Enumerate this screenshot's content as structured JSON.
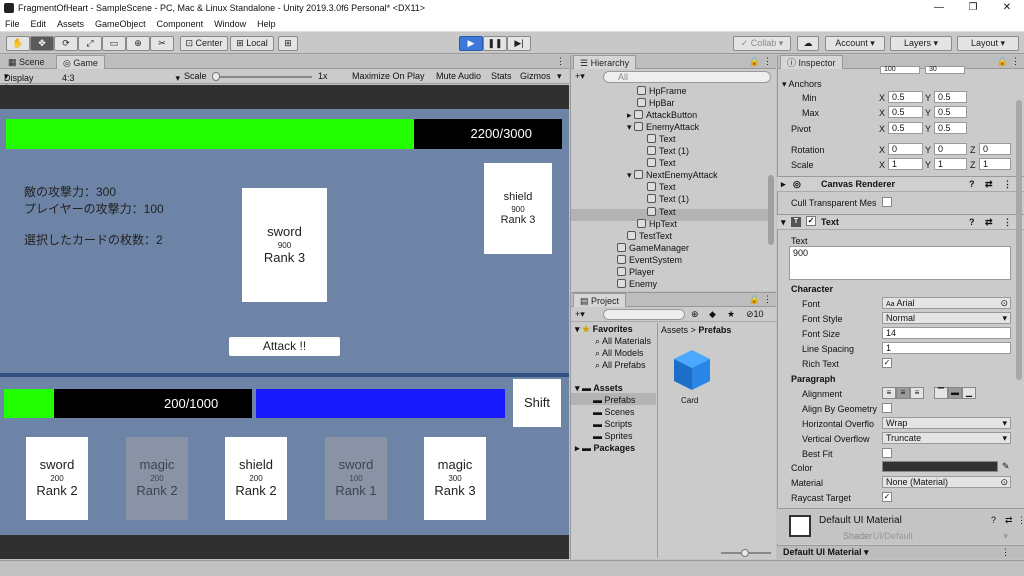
{
  "window": {
    "title": "FragmentOfHeart - SampleScene - PC, Mac & Linux Standalone - Unity 2019.3.0f6 Personal* <DX11>"
  },
  "menu": [
    "File",
    "Edit",
    "Assets",
    "GameObject",
    "Component",
    "Window",
    "Help"
  ],
  "toolbar": {
    "center": "Center",
    "local": "Local",
    "collab": "Collab",
    "account": "Account",
    "layers": "Layers",
    "layout": "Layout"
  },
  "tabs": {
    "scene": "Scene",
    "game": "Game"
  },
  "gamebar": {
    "display": "Display 1",
    "aspect": "4:3",
    "scale_label": "Scale",
    "scale_value": "1x",
    "maximize": "Maximize On Play",
    "mute": "Mute Audio",
    "stats": "Stats",
    "gizmos": "Gizmos"
  },
  "game": {
    "enemy_hp_text": "2200/3000",
    "enemy_hp_fraction": 0.7333,
    "enemy_attack_line": "敵の攻撃力：300",
    "player_attack_line": "プレイヤーの攻撃力：100",
    "selected_cards_line": "選択したカードの枚数：2",
    "attack_button": "Attack !!",
    "player_hp_text": "200/1000",
    "player_hp_fraction": 0.2,
    "shift_button": "Shift",
    "selected_card": {
      "name": "sword",
      "power": "900",
      "rank": "Rank 3"
    },
    "enemy_card": {
      "name": "shield",
      "power": "900",
      "rank": "Rank 3"
    },
    "hand": [
      {
        "name": "sword",
        "power": "200",
        "rank": "Rank 2"
      },
      {
        "name": "magic",
        "power": "200",
        "rank": "Rank 2"
      },
      {
        "name": "shield",
        "power": "200",
        "rank": "Rank 2"
      },
      {
        "name": "sword",
        "power": "100",
        "rank": "Rank 1"
      },
      {
        "name": "magic",
        "power": "300",
        "rank": "Rank 3"
      }
    ],
    "colors": {
      "bg": "#6d84a6",
      "green": "#22ff00",
      "blue": "#1a1aff",
      "black": "#000000"
    }
  },
  "hierarchy": {
    "title": "Hierarchy",
    "search_placeholder": "All",
    "items": [
      "HpFrame",
      "HpBar",
      "AttackButton",
      "EnemyAttack",
      "Text",
      "Text (1)",
      "Text",
      "NextEnemyAttack",
      "Text",
      "Text (1)",
      "Text",
      "HpText",
      "TestText",
      "GameManager",
      "EventSystem",
      "Player",
      "Enemy"
    ]
  },
  "project": {
    "title": "Project",
    "count": "10",
    "tree": [
      "Favorites",
      "All Materials",
      "All Models",
      "All Prefabs",
      "Assets",
      "Prefabs",
      "Scenes",
      "Scripts",
      "Sprites",
      "Packages"
    ],
    "breadcrumb_root": "Assets",
    "breadcrumb_sep": ">",
    "breadcrumb_leaf": "Prefabs",
    "asset": "Card"
  },
  "inspector": {
    "title": "Inspector",
    "top_values": [
      "100",
      "30"
    ],
    "anchors": "Anchors",
    "min": "Min",
    "max": "Max",
    "pivot": "Pivot",
    "rotation": "Rotation",
    "scale": "Scale",
    "min_x": "0.5",
    "min_y": "0.5",
    "max_x": "0.5",
    "max_y": "0.5",
    "pivot_x": "0.5",
    "pivot_y": "0.5",
    "rot_x": "0",
    "rot_y": "0",
    "rot_z": "0",
    "scale_x": "1",
    "scale_y": "1",
    "scale_z": "1",
    "canvas_renderer": "Canvas Renderer",
    "cull": "Cull Transparent Mes",
    "text_component": "Text",
    "text_label": "Text",
    "text_value": "900",
    "character": "Character",
    "font": "Font",
    "font_value": "Arial",
    "font_style": "Font Style",
    "font_style_value": "Normal",
    "font_size": "Font Size",
    "font_size_value": "14",
    "line_spacing": "Line Spacing",
    "line_spacing_value": "1",
    "rich_text": "Rich Text",
    "paragraph": "Paragraph",
    "alignment": "Alignment",
    "align_geom": "Align By Geometry",
    "h_overflow": "Horizontal Overflo",
    "h_overflow_value": "Wrap",
    "v_overflow": "Vertical Overflow",
    "v_overflow_value": "Truncate",
    "best_fit": "Best Fit",
    "color": "Color",
    "material": "Material",
    "material_value": "None (Material)",
    "raycast": "Raycast Target",
    "default_mat": "Default UI Material",
    "shader": "Shader",
    "shader_value": "UI/Default",
    "footer": "Default UI Material"
  }
}
